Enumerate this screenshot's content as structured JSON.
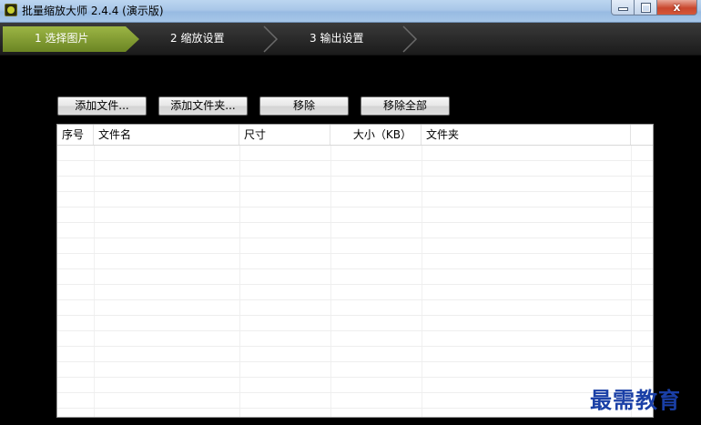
{
  "window": {
    "title": "批量缩放大师 2.4.4 (演示版)",
    "close_glyph": "x"
  },
  "steps": [
    {
      "label": "1 选择图片",
      "active": true
    },
    {
      "label": "2 缩放设置",
      "active": false
    },
    {
      "label": "3 输出设置",
      "active": false
    }
  ],
  "toolbar": {
    "add_file": "添加文件...",
    "add_folder": "添加文件夹...",
    "remove": "移除",
    "remove_all": "移除全部"
  },
  "table": {
    "columns": [
      "序号",
      "文件名",
      "尺寸",
      "大小（KB）",
      "文件夹"
    ],
    "rows": []
  },
  "watermark": "最需教育",
  "colors": {
    "step_active": "#7f9a2e",
    "accent_close": "#c9472e",
    "watermark": "#1a3fa6"
  }
}
